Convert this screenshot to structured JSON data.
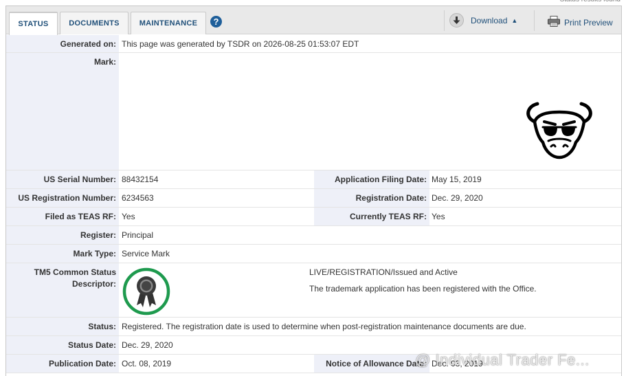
{
  "corner_text": "Status results found",
  "tabs": [
    {
      "label": "STATUS",
      "active": true
    },
    {
      "label": "DOCUMENTS",
      "active": false
    },
    {
      "label": "MAINTENANCE",
      "active": false
    }
  ],
  "help_icon": "?",
  "toolbar": {
    "download_label": "Download",
    "download_icon": "download-arrow-icon",
    "print_preview_label": "Print Preview",
    "print_icon": "printer-icon"
  },
  "record": {
    "generated_on_label": "Generated on:",
    "generated_on_value": "This page was generated by TSDR on 2026-08-25 01:53:07 EDT",
    "mark_label": "Mark:",
    "serial_label": "US Serial Number:",
    "serial_value": "88432154",
    "filing_date_label": "Application Filing Date:",
    "filing_date_value": "May 15, 2019",
    "registration_label": "US Registration Number:",
    "registration_value": "6234563",
    "registration_date_label": "Registration Date:",
    "registration_date_value": "Dec. 29, 2020",
    "teas_label": "Filed as TEAS RF:",
    "teas_value": "Yes",
    "current_teas_label": "Currently TEAS RF:",
    "current_teas_value": "Yes",
    "register_label": "Register:",
    "register_value": "Principal",
    "mark_type_label": "Mark Type:",
    "mark_type_value": "Service Mark",
    "tm5_label_line1": "TM5 Common Status",
    "tm5_label_line2": "Descriptor:",
    "tm5_status": "LIVE/REGISTRATION/Issued and Active",
    "tm5_description": "The trademark application has been registered with the Office.",
    "status_label": "Status:",
    "status_value": "Registered. The registration date is used to determine when post-registration maintenance documents are due.",
    "status_date_label": "Status Date:",
    "status_date_value": "Dec. 29, 2020",
    "publication_date_label": "Publication Date:",
    "publication_date_value": "Oct. 08, 2019",
    "allowance_label": "Notice of Allowance Date:",
    "allowance_value": "Dec. 03, 2019"
  },
  "watermark": "@ Individual Trader Fe...",
  "colors": {
    "label_bg": "#eef0f8",
    "link_blue": "#1f4f79",
    "badge_green": "#1e9a4e"
  }
}
